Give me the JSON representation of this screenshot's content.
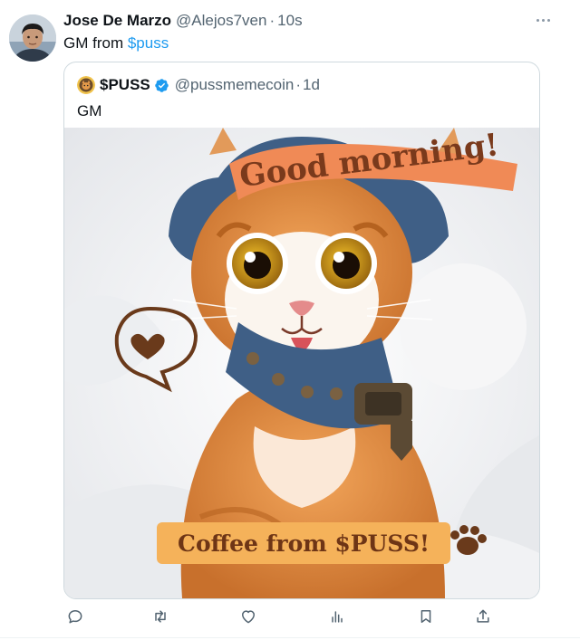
{
  "tweet": {
    "display_name": "Jose De Marzo",
    "handle": "@Alejos7ven",
    "separator": "·",
    "time": "10s",
    "text_prefix": "GM from ",
    "cashtag": "$puss"
  },
  "quoted_tweet": {
    "display_name": "$PUSS",
    "verified": true,
    "handle": "@pussmemecoin",
    "separator": "·",
    "time": "1d",
    "text": "GM",
    "image": {
      "top_banner_text": "Good morning!",
      "bottom_banner_text": "Coffee from $PUSS!"
    }
  },
  "actions": [
    "reply-icon",
    "retweet-icon",
    "like-icon",
    "views-icon",
    "bookmark-icon",
    "share-icon"
  ],
  "colors": {
    "link": "#1d9bf0",
    "secondary_text": "#536471",
    "border": "#cfd9de"
  }
}
